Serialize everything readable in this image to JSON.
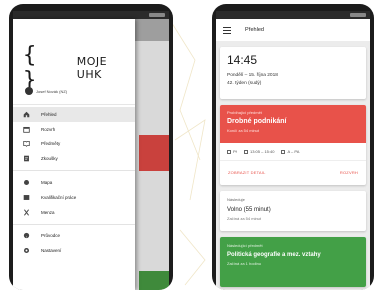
{
  "left_phone": {
    "logo": {
      "braces": "{ }",
      "text": "MOJE UHK"
    },
    "user_name": "Josef Novák (NZ)",
    "drawer_items": [
      {
        "label": "Přehled",
        "icon": "home-icon"
      },
      {
        "label": "Rozvrh",
        "icon": "calendar-icon"
      },
      {
        "label": "Předměty",
        "icon": "book-icon"
      },
      {
        "label": "Zkoušky",
        "icon": "exam-icon"
      },
      {
        "label": "Mapa",
        "icon": "map-icon"
      },
      {
        "label": "Kvalifikační práce",
        "icon": "thesis-icon"
      },
      {
        "label": "Menza",
        "icon": "fork-knife-icon"
      },
      {
        "label": "Průvodce",
        "icon": "help-icon"
      },
      {
        "label": "Nastavení",
        "icon": "gear-icon"
      }
    ]
  },
  "right_phone": {
    "app_bar_title": "Přehled",
    "time": "14:45",
    "date": "Pondělí – 15. října 2018",
    "week": "42. týden (sudý)",
    "current": {
      "subtitle": "Probíhající předmět",
      "name": "Drobné podnikání",
      "ends": "Končí za 54 minut",
      "type": "Př",
      "time_range": "13:05 – 15:40",
      "room": "A – PA",
      "action_left": "ZOBRAZIT DETAIL",
      "action_right": "ROZVRH"
    },
    "next": {
      "subtitle": "Následuje",
      "title": "Volno (55 minut)",
      "starts": "Začíná za 54 minut"
    },
    "upcoming": {
      "subtitle": "Následující předmět",
      "name": "Politická geografie a mez. vztahy",
      "starts": "Začíná za 1 hodinu"
    }
  },
  "colors": {
    "current_card": "#e8524a",
    "upcoming_card": "#43a047",
    "active_item": "#e8e8e8"
  }
}
